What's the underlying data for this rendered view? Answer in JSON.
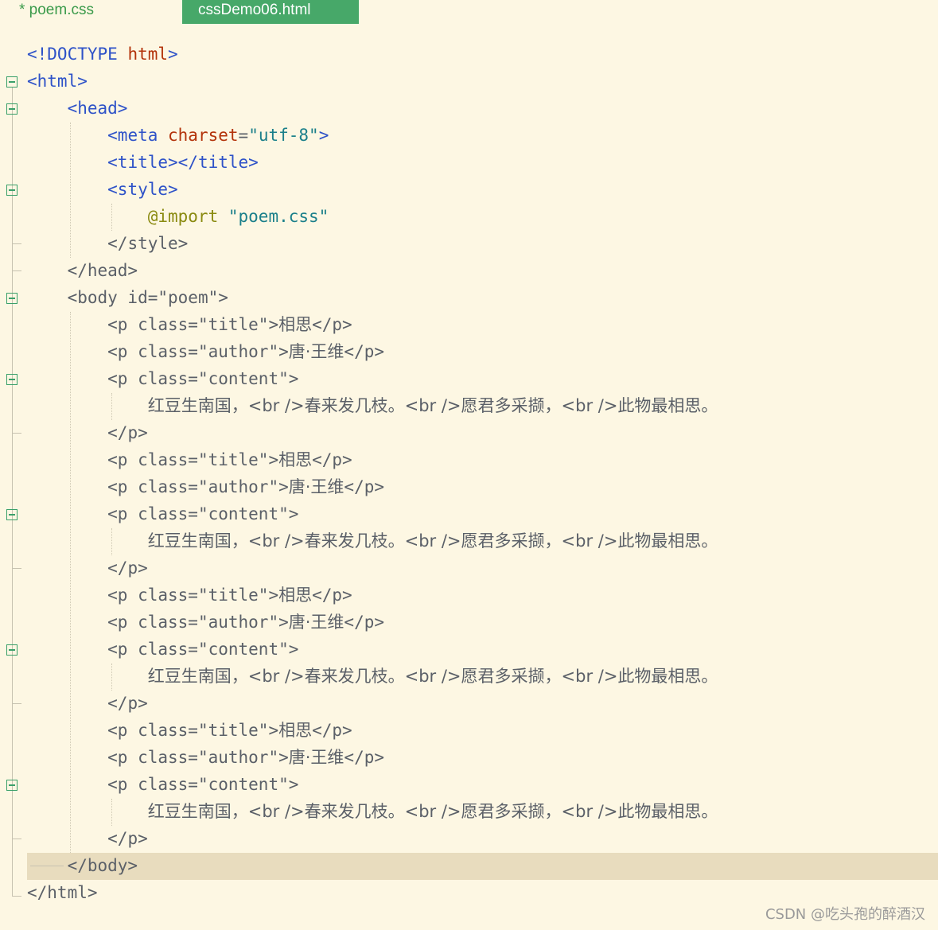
{
  "tabs": [
    {
      "label": "* poem.css",
      "active": false
    },
    {
      "label": "cssDemo06.html",
      "active": true
    }
  ],
  "code": {
    "doctype_open": "<!DOCTYPE",
    "doctype_html": " html",
    "doctype_close": ">",
    "html_open": "<html>",
    "head_open": "<head>",
    "meta_open": "<meta",
    "meta_attr": " charset",
    "meta_eq": "=",
    "meta_val": "\"utf-8\"",
    "meta_close": ">",
    "title_tag": "<title></title>",
    "style_open": "<style>",
    "import_kw": "@import",
    "import_val": " \"poem.css\"",
    "style_close": "</style>",
    "head_close": "</head>",
    "body_open": "<body id=\"poem\">",
    "p_title_open": "<p class=\"title\">",
    "title_text": "相思",
    "p_close": "</p>",
    "p_author_open": "<p class=\"author\">",
    "author_text": "唐·王维",
    "p_content_open": "<p class=\"content\">",
    "content_line": "红豆生南国，<br />春来发几枝。<br />愿君多采撷，<br />此物最相思。",
    "body_close": "</body>",
    "html_close": "</html>"
  },
  "watermark": "CSDN @吃头孢的醉酒汉",
  "colors": {
    "background": "#fdf7e3",
    "active_tab": "#47a869",
    "tag": "#2e52c8",
    "keyword": "#b3330a",
    "string": "#1a7f8a",
    "text": "#5b6068",
    "current_line": "#e8dcbe"
  }
}
